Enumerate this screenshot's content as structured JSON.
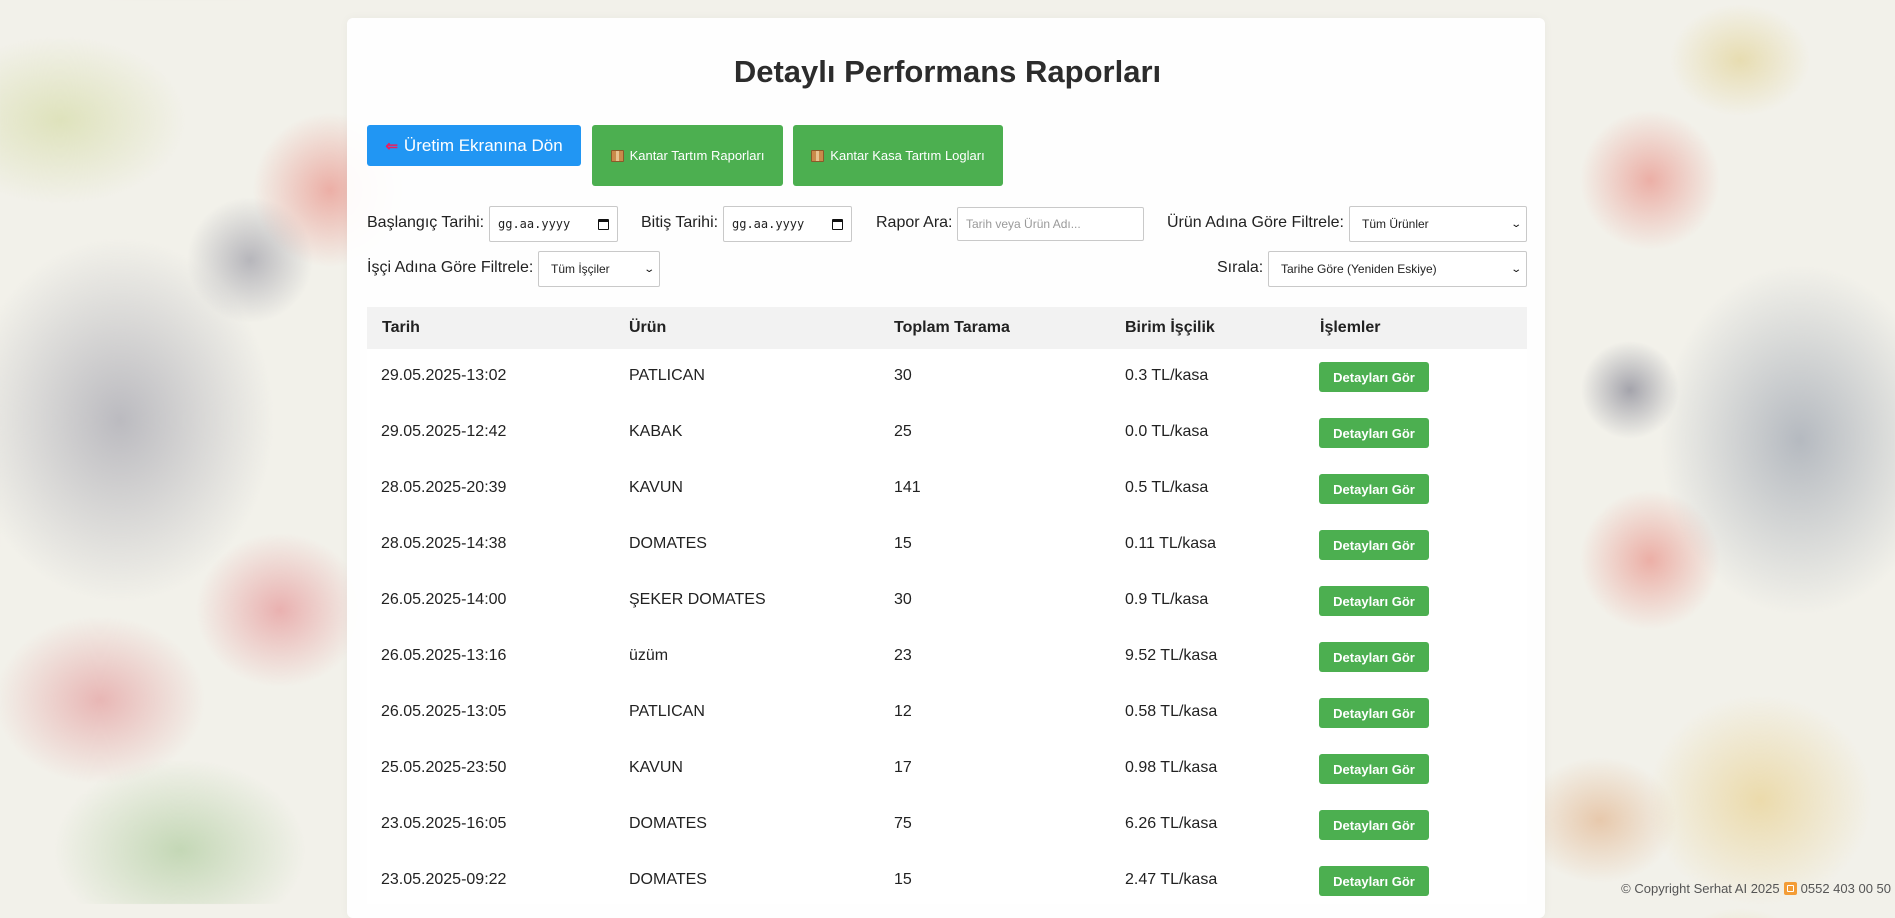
{
  "page": {
    "title": "Detaylı Performans Raporları"
  },
  "toolbar": {
    "back_button": {
      "icon": "arrow-left-icon",
      "label": "Üretim Ekranına Dön"
    },
    "scale_reports_button": {
      "icon": "package-icon",
      "label": "Kantar Tartım Raporları"
    },
    "crate_logs_button": {
      "icon": "package-icon",
      "label": "Kantar Kasa Tartım Logları"
    }
  },
  "filters": {
    "start_date": {
      "label": "Başlangıç Tarihi:",
      "placeholder": "gg.aa.yyyy"
    },
    "end_date": {
      "label": "Bitiş Tarihi:",
      "placeholder": "gg.aa.yyyy"
    },
    "search": {
      "label": "Rapor Ara:",
      "placeholder": "Tarih veya Ürün Adı..."
    },
    "product_filter": {
      "label": "Ürün Adına Göre Filtrele:",
      "selected": "Tüm Ürünler"
    },
    "worker_filter": {
      "label": "İşçi Adına Göre Filtrele:",
      "selected": "Tüm İşçiler"
    },
    "sort": {
      "label": "Sırala:",
      "selected": "Tarihe Göre (Yeniden Eskiye)"
    }
  },
  "table": {
    "headers": [
      "Tarih",
      "Ürün",
      "Toplam Tarama",
      "Birim İşçilik",
      "İşlemler"
    ],
    "action_label": "Detayları Gör",
    "rows": [
      {
        "date": "29.05.2025-13:02",
        "product": "PATLICAN",
        "scans": "30",
        "labor": "0.3 TL/kasa"
      },
      {
        "date": "29.05.2025-12:42",
        "product": "KABAK",
        "scans": "25",
        "labor": "0.0 TL/kasa"
      },
      {
        "date": "28.05.2025-20:39",
        "product": "KAVUN",
        "scans": "141",
        "labor": "0.5 TL/kasa"
      },
      {
        "date": "28.05.2025-14:38",
        "product": "DOMATES",
        "scans": "15",
        "labor": "0.11 TL/kasa"
      },
      {
        "date": "26.05.2025-14:00",
        "product": "ŞEKER DOMATES",
        "scans": "30",
        "labor": "0.9 TL/kasa"
      },
      {
        "date": "26.05.2025-13:16",
        "product": "üzüm",
        "scans": "23",
        "labor": "9.52 TL/kasa"
      },
      {
        "date": "26.05.2025-13:05",
        "product": "PATLICAN",
        "scans": "12",
        "labor": "0.58 TL/kasa"
      },
      {
        "date": "25.05.2025-23:50",
        "product": "KAVUN",
        "scans": "17",
        "labor": "0.98 TL/kasa"
      },
      {
        "date": "23.05.2025-16:05",
        "product": "DOMATES",
        "scans": "75",
        "labor": "6.26 TL/kasa"
      },
      {
        "date": "23.05.2025-09:22",
        "product": "DOMATES",
        "scans": "15",
        "labor": "2.47 TL/kasa"
      }
    ]
  },
  "footer": {
    "copyright": "© Copyright Serhat AI 2025",
    "phone_icon": "phone-icon",
    "phone": "0552 403 00 50"
  },
  "colors": {
    "primary_blue": "#2196f3",
    "action_green": "#4caf50",
    "header_bg": "#f2f2f2"
  }
}
